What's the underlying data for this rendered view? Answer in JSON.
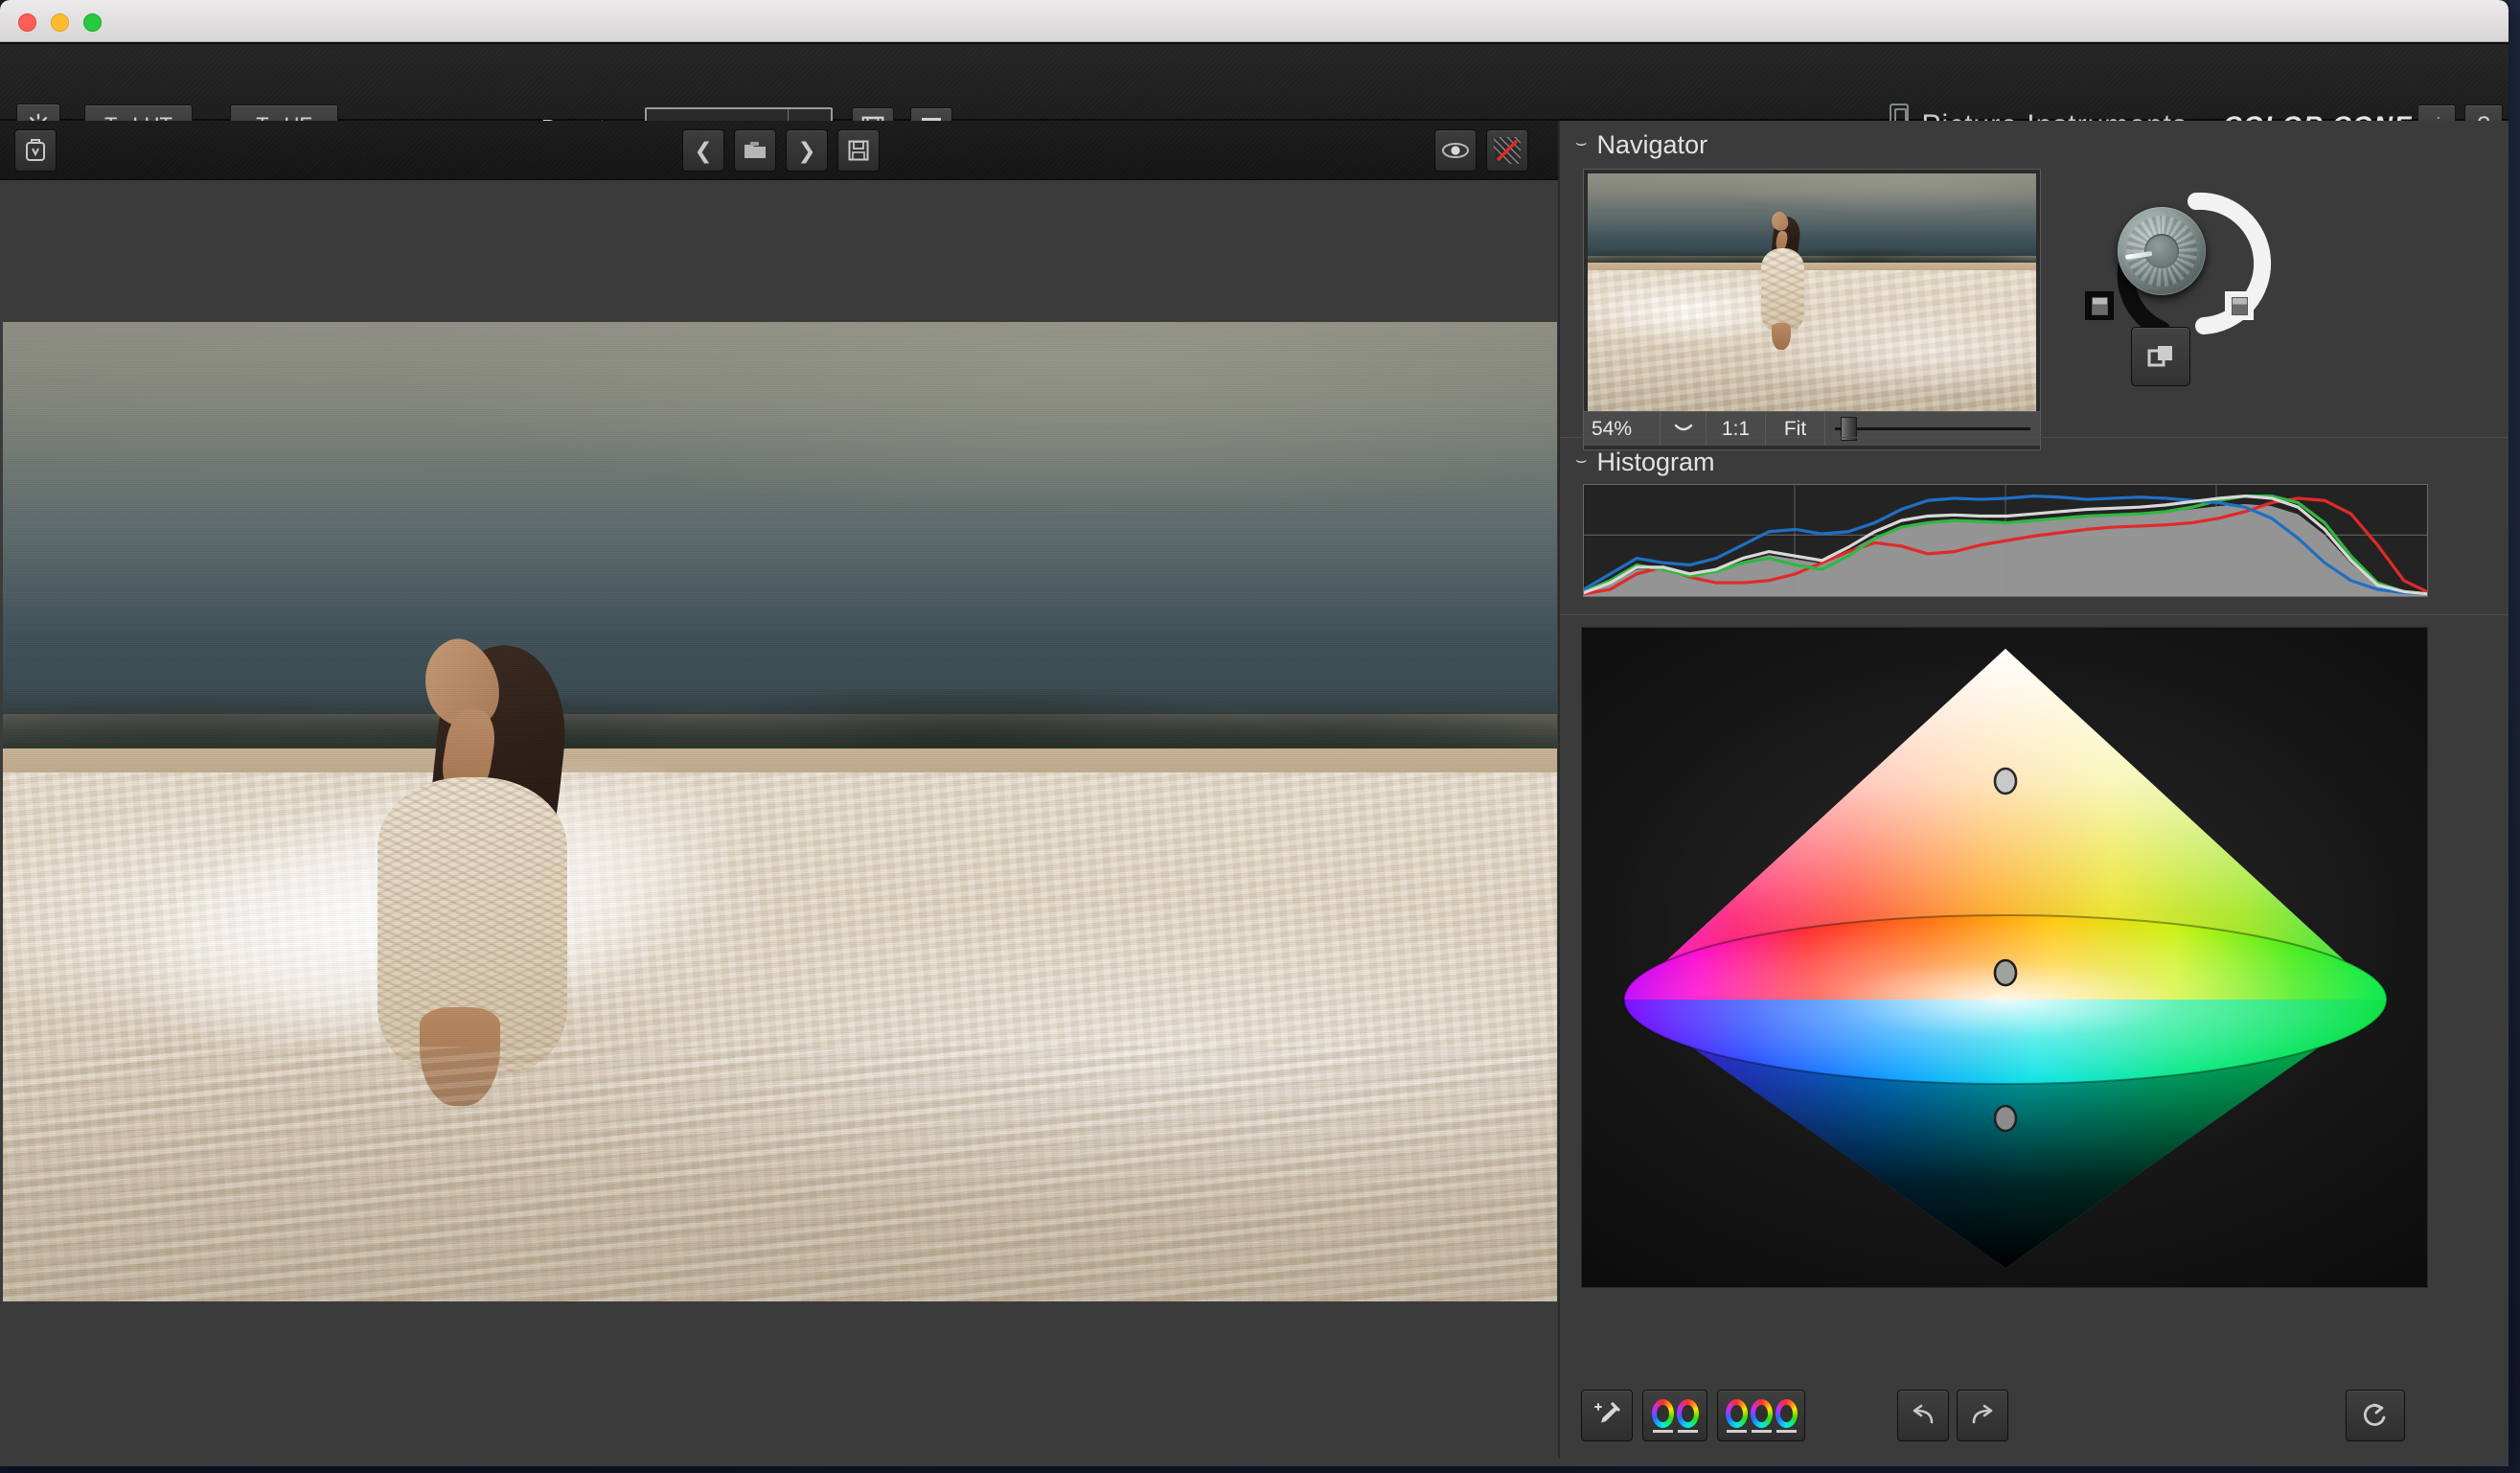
{
  "window": {
    "traffic_lights": [
      "close",
      "minimize",
      "zoom"
    ]
  },
  "toolbar": {
    "gear_icon": "gear-icon",
    "to_lut_label": "To LUT",
    "to_uf_label": "To UF",
    "presets_label": "Presets:",
    "presets_value": "",
    "presets_placeholder": "",
    "presets_dropdown_icon": "chevron-down-icon",
    "presets_save_icon": "floppy-disk-icon",
    "presets_delete_icon": "trash-icon",
    "brand_name": "Picture Instruments",
    "brand_separator": "-",
    "brand_product": "COLOR CONE",
    "info_label": "i",
    "help_label": "?"
  },
  "image_toolbar": {
    "basket_icon": "basket-icon",
    "prev_label": "❮",
    "open_icon": "folder-icon",
    "next_label": "❯",
    "save_icon": "floppy-disk-icon",
    "preview_icon": "eye-icon",
    "clipping_icon": "clipping-warning-icon"
  },
  "navigator": {
    "title": "Navigator",
    "twisty": "⌣",
    "zoom_percent": "54%",
    "zoom_dropdown_icon": "chevron-down-icon",
    "zoom_one_to_one": "1:1",
    "zoom_fit": "Fit",
    "zoom_slider_value": 3,
    "dial_name": "rotation-dial",
    "swatch_black": "#0a0a0a",
    "swatch_white": "#f0f0f0",
    "copy_icon": "copy-icon"
  },
  "histogram": {
    "title": "Histogram",
    "twisty": "⌣"
  },
  "chart_data": {
    "type": "line",
    "title": "Histogram",
    "xlabel": "",
    "ylabel": "",
    "xlim": [
      0,
      255
    ],
    "ylim": [
      0,
      100
    ],
    "grid": true,
    "legend_position": "none",
    "x": [
      0,
      8,
      16,
      24,
      32,
      40,
      48,
      56,
      64,
      72,
      80,
      88,
      96,
      104,
      112,
      120,
      128,
      136,
      144,
      152,
      160,
      168,
      176,
      184,
      192,
      200,
      208,
      216,
      224,
      232,
      240,
      248,
      255
    ],
    "series": [
      {
        "name": "Red",
        "color": "#e02a28",
        "values": [
          2,
          6,
          20,
          26,
          17,
          12,
          12,
          14,
          20,
          30,
          40,
          48,
          45,
          38,
          40,
          46,
          50,
          54,
          57,
          60,
          62,
          63,
          64,
          66,
          70,
          76,
          84,
          88,
          86,
          74,
          46,
          14,
          4
        ]
      },
      {
        "name": "Green",
        "color": "#2fb842",
        "values": [
          4,
          14,
          28,
          24,
          18,
          22,
          30,
          34,
          28,
          24,
          36,
          52,
          62,
          66,
          68,
          67,
          66,
          68,
          70,
          72,
          73,
          74,
          76,
          80,
          86,
          90,
          90,
          84,
          66,
          36,
          12,
          4,
          2
        ]
      },
      {
        "name": "Blue",
        "color": "#1f6fc4",
        "values": [
          6,
          20,
          34,
          30,
          28,
          34,
          46,
          58,
          60,
          56,
          58,
          66,
          78,
          86,
          88,
          87,
          88,
          90,
          89,
          87,
          88,
          89,
          88,
          86,
          84,
          80,
          70,
          52,
          30,
          14,
          6,
          3,
          2
        ]
      },
      {
        "name": "Luminance",
        "color": "#d8d8d8",
        "values": [
          3,
          12,
          26,
          26,
          20,
          24,
          34,
          40,
          36,
          32,
          44,
          58,
          68,
          72,
          73,
          72,
          72,
          74,
          76,
          78,
          79,
          80,
          82,
          85,
          88,
          90,
          88,
          80,
          60,
          32,
          10,
          4,
          2
        ]
      }
    ]
  },
  "color_cone": {
    "handles": [
      {
        "name": "highlights-handle",
        "x_pct": 50,
        "y_pct": 23
      },
      {
        "name": "midtones-handle",
        "x_pct": 50,
        "y_pct": 52
      },
      {
        "name": "shadows-handle",
        "x_pct": 50,
        "y_pct": 74
      }
    ],
    "tools": {
      "picker_icon": "eyedropper-add-icon",
      "two_wheel_icon": "two-color-wheels-icon",
      "three_wheel_icon": "three-color-wheels-icon",
      "undo_icon": "undo-arrow-icon",
      "redo_icon": "redo-arrow-icon",
      "reset_icon": "reset-circular-arrow-icon"
    }
  },
  "colors": {
    "window_bg": "#3b3b3b",
    "toolbar_bg": "#1d1d1d",
    "accent_red": "#e02a28",
    "accent_green": "#2fb842",
    "accent_blue": "#1f6fc4",
    "desktop_bg": "#1b2237"
  }
}
